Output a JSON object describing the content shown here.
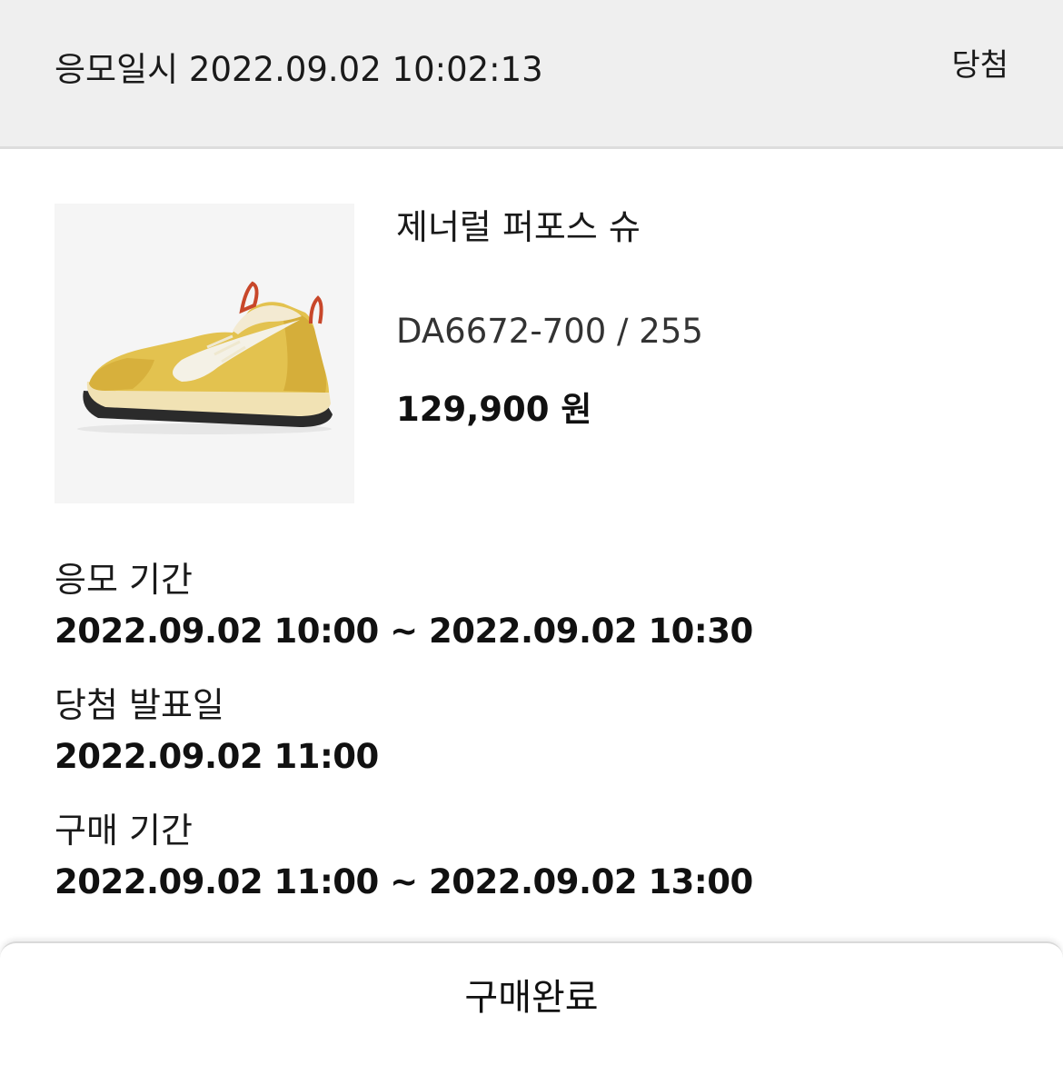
{
  "header": {
    "entry_datetime": "응모일시 2022.09.02 10:02:13",
    "status": "당첨"
  },
  "product": {
    "image_icon": "sneaker-photo",
    "name": "제너럴 퍼포스 슈",
    "code_size": "DA6672-700 / 255",
    "price": "129,900 원"
  },
  "info": {
    "entry_period_label": "응모 기간",
    "entry_period_value": "2022.09.02 10:00 ~ 2022.09.02 10:30",
    "announce_label": "당첨 발표일",
    "announce_value": "2022.09.02 11:00",
    "purchase_period_label": "구매 기간",
    "purchase_period_value": "2022.09.02 11:00 ~ 2022.09.02 13:00"
  },
  "footer": {
    "button_label": "구매완료"
  },
  "colors": {
    "header_bg": "#efefef",
    "image_bg": "#f5f5f5",
    "shoe_yellow": "#e3c24f",
    "shoe_swoosh": "#f4f1e6",
    "shoe_sole": "#f1e2b4",
    "lace_tab": "#c8472a"
  }
}
